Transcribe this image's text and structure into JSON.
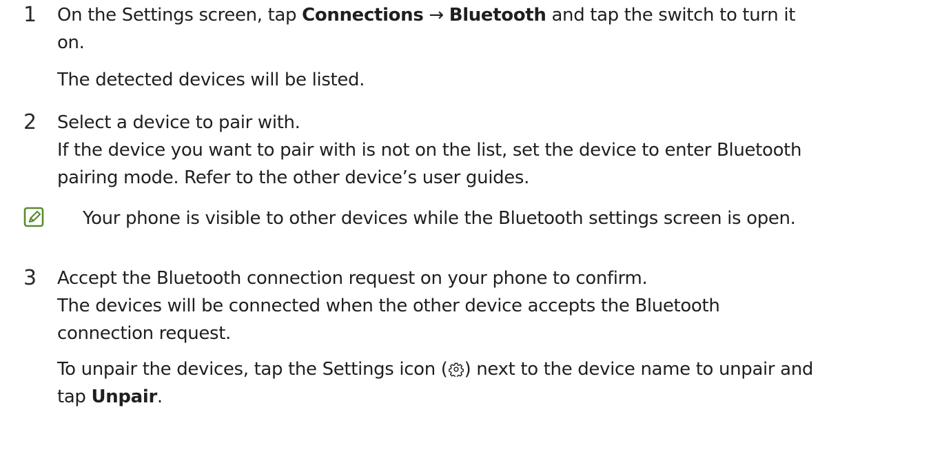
{
  "steps": [
    {
      "number": "1",
      "lines": {
        "l1": {
          "a": "On the Settings screen, tap ",
          "b1": "Connections",
          "arrow": " → ",
          "b2": "Bluetooth",
          "c": " and tap the switch to turn it"
        },
        "l2": "on.",
        "l3": "The detected devices will be listed."
      }
    },
    {
      "number": "2",
      "lines": {
        "l1": "Select a device to pair with.",
        "l2": "If the device you want to pair with is not on the list, set the device to enter Bluetooth",
        "l3": "pairing mode. Refer to the other device’s user guides."
      }
    },
    {
      "number": "3",
      "lines": {
        "l1": "Accept the Bluetooth connection request on your phone to confirm.",
        "l2": "The devices will be connected when the other device accepts the Bluetooth",
        "l3": "connection request.",
        "l4": {
          "a": "To unpair the devices, tap the Settings icon (",
          "b": ") next to the device name to unpair and"
        },
        "l5": {
          "a": "tap ",
          "b": "Unpair",
          "c": "."
        }
      }
    }
  ],
  "note": {
    "icon": "note-icon",
    "text": "Your phone is visible to other devices while the Bluetooth settings screen is open."
  },
  "icons": {
    "note_color": "#5a8a2e",
    "settings_icon": "gear-icon"
  }
}
